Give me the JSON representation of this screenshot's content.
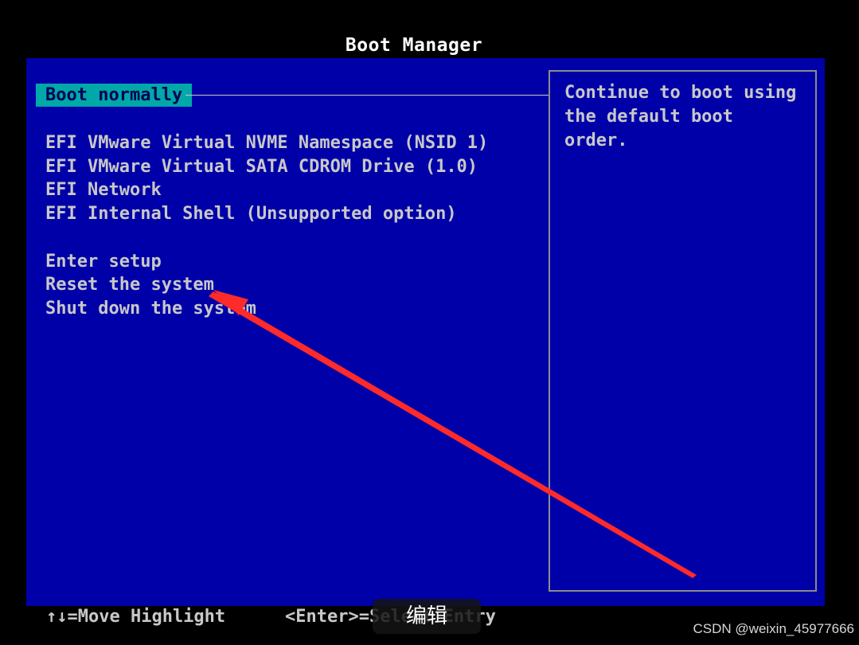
{
  "title": "Boot Manager",
  "menu": {
    "selected": "Boot normally",
    "devices": [
      "EFI VMware Virtual NVME Namespace (NSID 1)",
      "EFI VMware Virtual SATA CDROM Drive (1.0)",
      "EFI Network",
      "EFI Internal Shell (Unsupported option)"
    ],
    "actions": [
      "Enter setup",
      "Reset the system",
      "Shut down the system"
    ]
  },
  "help": {
    "lines": [
      "Continue to boot using",
      "the default boot order."
    ]
  },
  "footer": {
    "move_hint": "↑↓=Move Highlight",
    "enter_hint": "<Enter>=Select Entry"
  },
  "overlay": {
    "edit_label": "编辑",
    "watermark": "CSDN @weixin_45977666"
  },
  "colors": {
    "background": "#0000a8",
    "highlight": "#00a8a8",
    "annotation_arrow": "#ff2a2a"
  }
}
